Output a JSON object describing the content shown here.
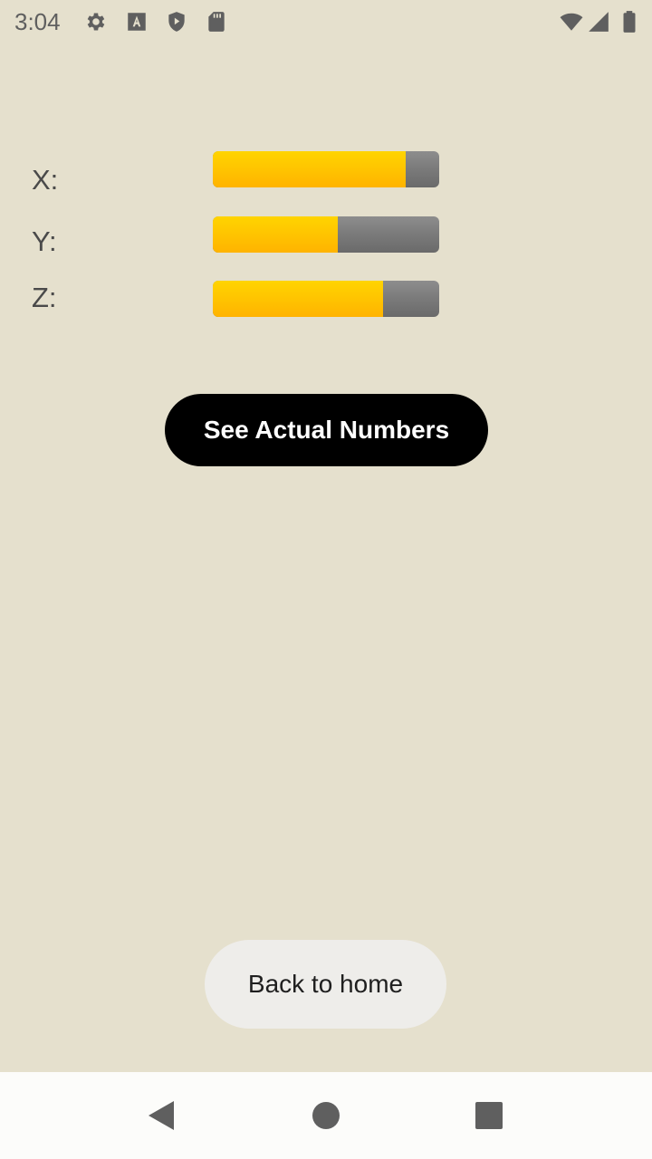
{
  "status_bar": {
    "time": "3:04",
    "icons": [
      "settings-icon",
      "text-a-icon",
      "shield-play-icon",
      "sd-card-icon",
      "wifi-icon",
      "signal-icon",
      "battery-icon"
    ]
  },
  "sensors": [
    {
      "label": "X:",
      "level": 0.85
    },
    {
      "label": "Y:",
      "level": 0.55
    },
    {
      "label": "Z:",
      "level": 0.75
    }
  ],
  "actions": {
    "see_numbers_label": "See Actual Numbers",
    "back_home_label": "Back to home"
  },
  "nav": {
    "buttons": [
      "back-icon",
      "home-icon",
      "recents-icon"
    ]
  },
  "colors": {
    "background": "#e5e0cd",
    "bar_fill": "#ffc400",
    "bar_track": "#7a7a7a",
    "primary_button": "#000000"
  }
}
